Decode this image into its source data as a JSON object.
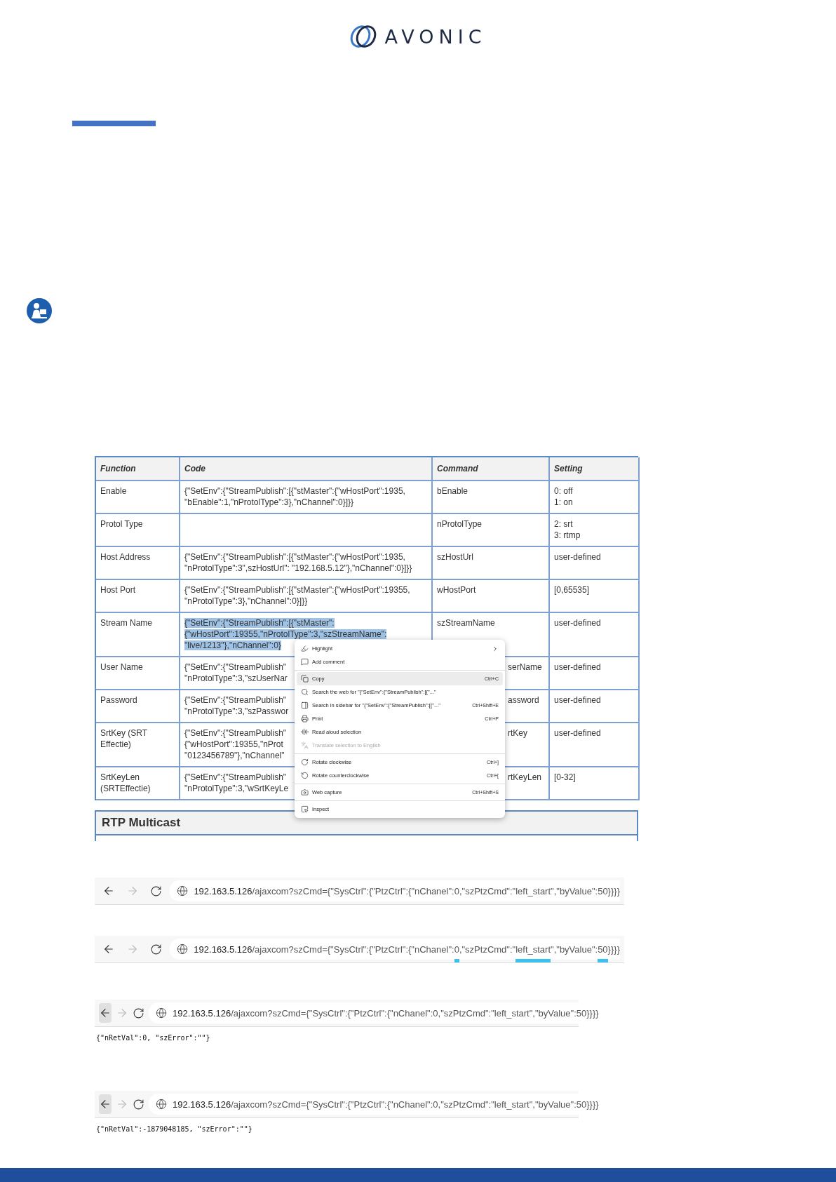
{
  "logo": {
    "text": "AVONIC"
  },
  "table": {
    "columns": [
      "Function",
      "Code",
      "Command",
      "Setting"
    ],
    "rows": [
      {
        "function": "Enable",
        "code": [
          "{\"SetEnv\":{\"StreamPublish\":[{\"stMaster\":{\"wHostPort\":1935,",
          "\"bEnable\":1,\"nProtolType\":3},\"nChannel\":0}]}}"
        ],
        "code_selected": false,
        "command": "bEnable",
        "setting": [
          "0: off",
          "1: on"
        ]
      },
      {
        "function": "Protol Type",
        "code": [],
        "code_selected": false,
        "command": "nProtolType",
        "setting": [
          "2: srt",
          "3: rtmp"
        ]
      },
      {
        "function": "Host Address",
        "code": [
          "{\"SetEnv\":{\"StreamPublish\":[{\"stMaster\":{\"wHostPort\":1935,",
          "\"nProtolType\":3\",szHostUrl\": \"192.168.5.12\"},\"nChannel\":0}]}}"
        ],
        "code_selected": false,
        "command": "szHostUrl",
        "setting": [
          "user-defined"
        ]
      },
      {
        "function": "Host Port",
        "code": [
          "{\"SetEnv\":{\"StreamPublish\":[{\"stMaster\":{\"wHostPort\":19355,",
          "\"nProtolType\":3},\"nChannel\":0}]}}"
        ],
        "code_selected": false,
        "command": "wHostPort",
        "setting": [
          "[0,65535]"
        ]
      },
      {
        "function": "Stream Name",
        "code": [
          "{\"SetEnv\":{\"StreamPublish\":[{\"stMaster\":",
          "{\"wHostPort\":19355,\"nProtolType\":3,\"szStreamName\":",
          "\"live/1213\"},\"nChannel\":0}"
        ],
        "code_selected": true,
        "command": "szStreamName",
        "setting": [
          "user-defined"
        ]
      },
      {
        "function": "User Name",
        "code": [
          "{\"SetEnv\":{\"StreamPublish\"",
          "\"nProtolType\":3,\"szUserNar"
        ],
        "code_selected": false,
        "command": "serName",
        "setting": [
          "user-defined"
        ]
      },
      {
        "function": "Password",
        "code": [
          "{\"SetEnv\":{\"StreamPublish\"",
          "\"nProtolType\":3,\"szPasswor"
        ],
        "code_selected": false,
        "command": "assword",
        "setting": [
          "user-defined"
        ]
      },
      {
        "function": "SrtKey (SRT Effectie)",
        "code": [
          "{\"SetEnv\":{\"StreamPublish\"",
          "{\"wHostPort\":19355,\"nProt",
          "\"0123456789\"},\"nChannel\""
        ],
        "code_selected": false,
        "command": "rtKey",
        "setting": [
          "user-defined"
        ]
      },
      {
        "function": "SrtKeyLen (SRTEffectie)",
        "code": [
          "{\"SetEnv\":{\"StreamPublish\"",
          "\"nProtolType\":3,\"wSrtKeyLe"
        ],
        "code_selected": false,
        "command": "rtKeyLen",
        "setting": [
          "[0-32]"
        ]
      }
    ]
  },
  "section_title": "RTP Multicast",
  "context_menu": {
    "groups": [
      [
        {
          "label": "Highlight",
          "submenu": true,
          "selected": false,
          "disabled": false
        },
        {
          "label": "Add comment",
          "submenu": false,
          "selected": false,
          "disabled": false
        }
      ],
      [
        {
          "label": "Copy",
          "shortcut": "Ctrl+C",
          "submenu": false,
          "selected": true,
          "disabled": false
        },
        {
          "label": "Search the web for \"{\"SetEnv\":{\"StreamPublish\":[{\"...\"",
          "submenu": false,
          "selected": false,
          "disabled": false
        },
        {
          "label": "Search in sidebar for \"{\"SetEnv\":{\"StreamPublish\":[{\"...\"",
          "shortcut": "Ctrl+Shift+E",
          "submenu": false,
          "selected": false,
          "disabled": false
        },
        {
          "label": "Print",
          "shortcut": "Ctrl+P",
          "submenu": false,
          "selected": false,
          "disabled": false
        },
        {
          "label": "Read aloud selection",
          "submenu": false,
          "selected": false,
          "disabled": false
        },
        {
          "label": "Translate selection to English",
          "submenu": false,
          "selected": false,
          "disabled": true
        }
      ],
      [
        {
          "label": "Rotate clockwise",
          "shortcut": "Ctrl+]",
          "submenu": false,
          "selected": false,
          "disabled": false
        },
        {
          "label": "Rotate counterclockwise",
          "shortcut": "Ctrl+[",
          "submenu": false,
          "selected": false,
          "disabled": false
        }
      ],
      [
        {
          "label": "Web capture",
          "shortcut": "Ctrl+Shift+S",
          "submenu": false,
          "selected": false,
          "disabled": false
        }
      ],
      [
        {
          "label": "Inspect",
          "submenu": false,
          "selected": false,
          "disabled": false
        }
      ]
    ]
  },
  "browser_shots": [
    {
      "back_pressed": false,
      "host": "192.163.5.126",
      "path": [
        {
          "text": "/ajaxcom?szCmd={\"SysCtrl\":{\"PtzCtrl\":{\"nChanel\":0,\"szPtzCmd\":\"left_start\",\"byValue\":50}}}}",
          "marked": false
        }
      ]
    },
    {
      "back_pressed": false,
      "host": "192.163.5.126",
      "path": [
        {
          "text": "/ajaxcom?szCmd={\"SysCtrl\":{\"PtzCtrl\":{\"nChanel\":",
          "marked": false
        },
        {
          "text": "0",
          "marked": true
        },
        {
          "text": ",\"szPtzCmd\":\"",
          "marked": false
        },
        {
          "text": "left_start",
          "marked": true
        },
        {
          "text": "\",\"byValue\":",
          "marked": false
        },
        {
          "text": "50",
          "marked": true
        },
        {
          "text": "}}}}",
          "marked": false
        }
      ]
    },
    {
      "back_pressed": true,
      "host": "192.163.5.126",
      "path": [
        {
          "text": "/ajaxcom?szCmd={\"SysCtrl\":{\"PtzCtrl\":{\"nChanel\":0,\"szPtzCmd\":\"left_start\",\"byValue\":50}}}}",
          "marked": false
        }
      ],
      "response": "{\"nRetVal\":0, \"szError\":\"\"}"
    },
    {
      "back_pressed": true,
      "host": "192.163.5.126",
      "path": [
        {
          "text": "/ajaxcom?szCmd={\"SysCtrl\":{\"PtzCtrl\":{\"nChanel\":0,\"szPtzCmd\":\"left_start\",\"byValue\":50}}}}",
          "marked": false
        }
      ],
      "response": "{\"nRetVal\":-1879048185, \"szError\":\"\"}"
    }
  ]
}
